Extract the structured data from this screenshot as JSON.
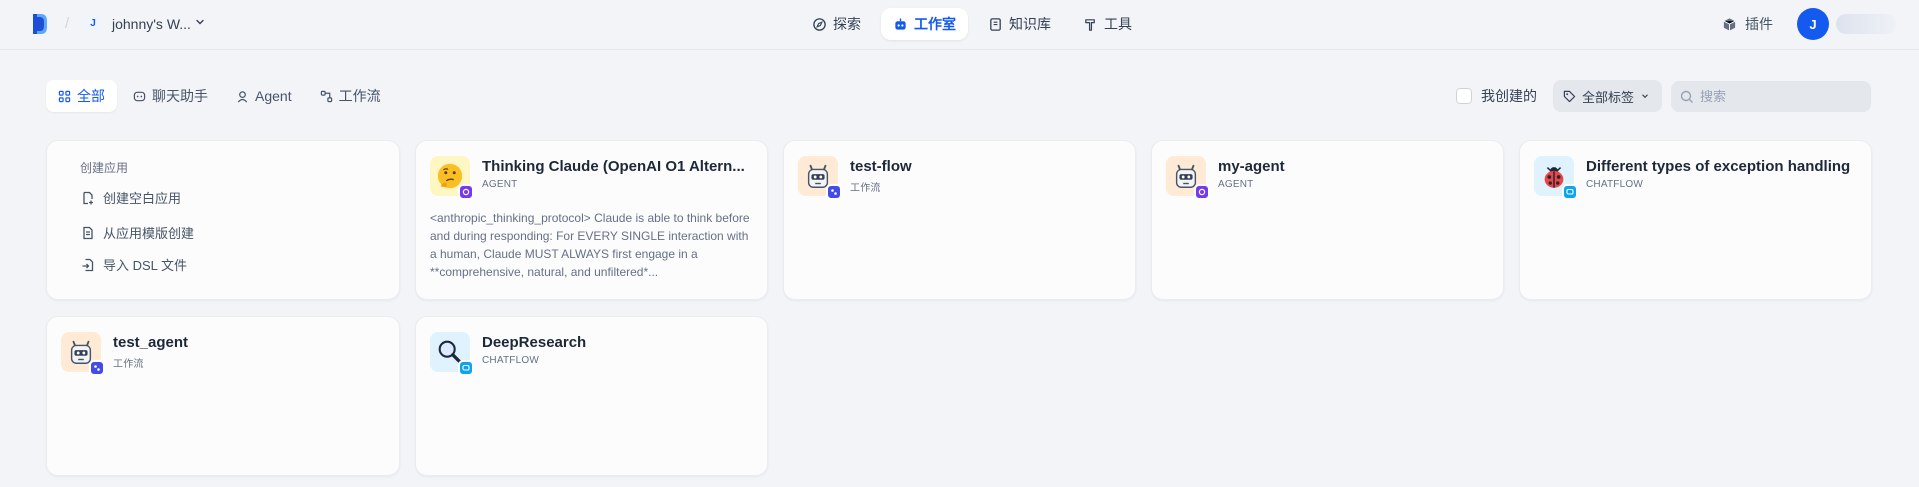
{
  "workspace": {
    "initial": "J",
    "name": "johnny's W..."
  },
  "nav": [
    {
      "label": "探索",
      "icon": "compass-icon"
    },
    {
      "label": "工作室",
      "icon": "robot-icon",
      "active": true
    },
    {
      "label": "知识库",
      "icon": "book-icon"
    },
    {
      "label": "工具",
      "icon": "hammer-icon"
    }
  ],
  "header_right": {
    "plugin_label": "插件",
    "user_initial": "J"
  },
  "tabs": [
    {
      "label": "全部",
      "icon": "grid-icon",
      "active": true
    },
    {
      "label": "聊天助手",
      "icon": "chat-icon"
    },
    {
      "label": "Agent",
      "icon": "agent-icon"
    },
    {
      "label": "工作流",
      "icon": "workflow-icon"
    }
  ],
  "filters": {
    "mine_label": "我创建的",
    "tags_label": "全部标签",
    "search_placeholder": "搜索"
  },
  "create": {
    "title": "创建应用",
    "blank": "创建空白应用",
    "template": "从应用模版创建",
    "import": "导入 DSL 文件"
  },
  "apps": [
    {
      "name": "Thinking Claude (OpenAI O1 Altern...",
      "type": "AGENT",
      "icon": "thinking-face-icon",
      "description": "<anthropic_thinking_protocol> Claude is able to think before and during responding: For EVERY SINGLE interaction with a human, Claude MUST ALWAYS first engage in a **comprehensive, natural, and unfiltered*..."
    },
    {
      "name": "test-flow",
      "type": "工作流",
      "icon": "robot-face-icon",
      "description": ""
    },
    {
      "name": "my-agent",
      "type": "AGENT",
      "icon": "robot-face-icon",
      "description": ""
    },
    {
      "name": "Different types of exception handling",
      "type": "CHATFLOW",
      "icon": "ladybug-icon",
      "description": ""
    },
    {
      "name": "test_agent",
      "type": "工作流",
      "icon": "robot-face-icon",
      "description": ""
    },
    {
      "name": "DeepResearch",
      "type": "CHATFLOW",
      "icon": "magnifier-icon",
      "description": ""
    }
  ],
  "colors": {
    "accent": "#155aef",
    "agent_badge": "#7839ee",
    "workflow_badge": "#444ce7",
    "chatflow_badge": "#0ba5ec"
  }
}
